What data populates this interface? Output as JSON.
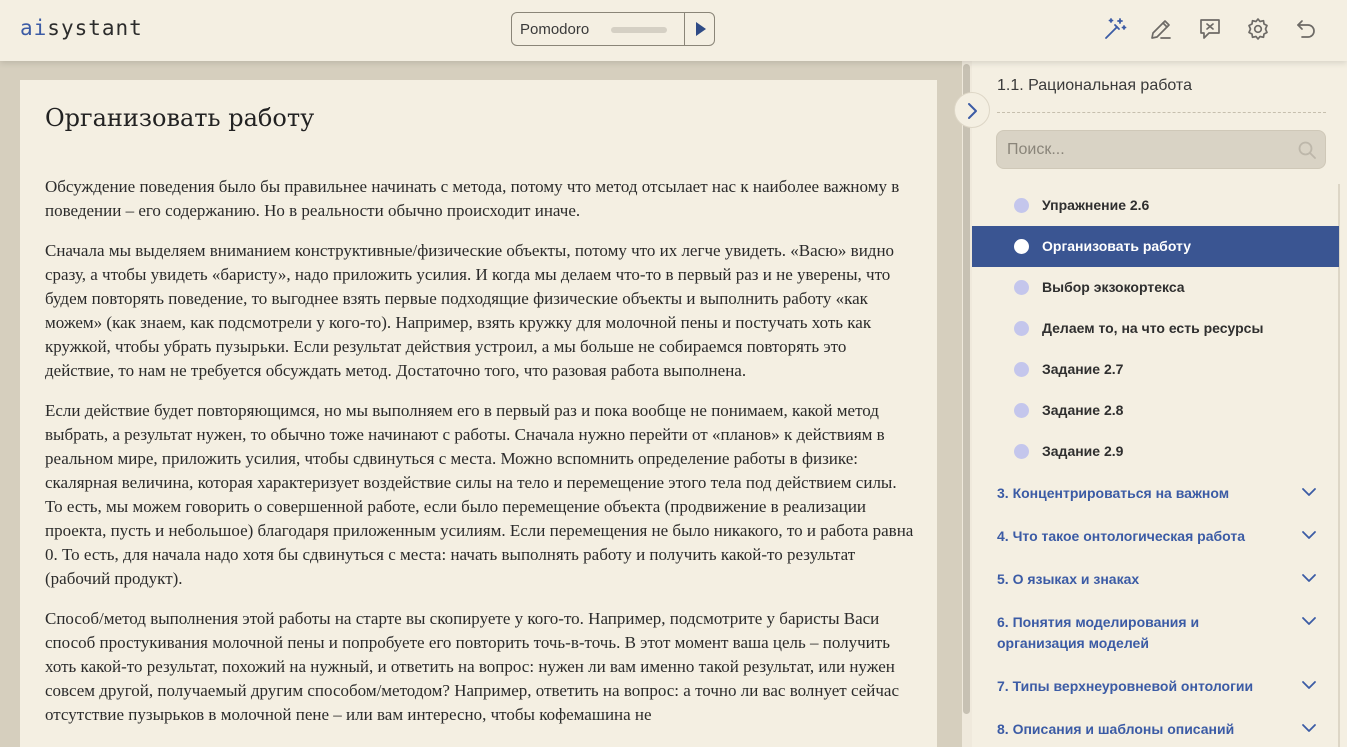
{
  "header": {
    "logo_ai": "ai",
    "logo_rest": "systant",
    "pomodoro": {
      "label": "Pomodoro",
      "progress": 0
    },
    "tools": [
      "magic-wand-icon",
      "pencil-icon",
      "feedback-icon",
      "settings-icon",
      "undo-icon"
    ]
  },
  "article": {
    "title": "Организовать работу",
    "paragraphs": [
      "Обсуждение поведения было бы правильнее начинать с метода, потому что метод отсылает нас к наиболее важному в поведении – его содержанию. Но в реальности обычно происходит иначе.",
      "Сначала мы выделяем вниманием конструктивные/физические объекты, потому что их легче увидеть. «Васю» видно сразу, а чтобы увидеть «баристу», надо приложить усилия. И когда мы делаем что-то в первый раз и не уверены, что будем повторять поведение, то выгоднее взять первые подходящие физические объекты и выполнить работу «как можем» (как знаем, как подсмотрели у кого-то). Например, взять кружку для молочной пены и постучать хоть как кружкой, чтобы убрать пузырьки. Если результат действия устроил, а мы больше не собираемся повторять это действие, то нам не требуется обсуждать метод. Достаточно того, что разовая работа выполнена.",
      "Если действие будет повторяющимся, но мы выполняем его в первый раз и пока вообще не понимаем, какой метод выбрать, а результат нужен, то обычно тоже начинают с работы. Сначала нужно перейти от «планов» к действиям в реальном мире, приложить усилия, чтобы сдвинуться с места. Можно вспомнить определение работы в физике: скалярная величина, которая характеризует воздействие силы на тело и перемещение этого тела под действием силы. То есть, мы можем говорить о совершенной работе, если было перемещение объекта (продвижение в реализации проекта, пусть и небольшое) благодаря приложенным усилиям. Если перемещения не было никакого, то и работа равна 0. То есть, для начала надо хотя бы сдвинуться с места: начать выполнять работу и получить какой-то результат (рабочий продукт).",
      "Способ/метод выполнения этой работы на старте вы скопируете у кого-то. Например, подсмотрите у баристы Васи способ простукивания молочной пены и попробуете его повторить точь-в-точь. В этот момент ваша цель – получить хоть какой-то результат, похожий на нужный, и ответить на вопрос: нужен ли вам именно такой результат, или нужен совсем другой, получаемый другим способом/методом? Например, ответить на вопрос: а точно ли вас волнует сейчас отсутствие пузырьков в молочной пене – или вам интересно, чтобы кофемашина не"
    ]
  },
  "sidebar": {
    "title": "1.1. Рациональная работа",
    "search_placeholder": "Поиск...",
    "lessons": [
      {
        "label": "Упражнение 2.6",
        "active": false
      },
      {
        "label": "Организовать работу",
        "active": true
      },
      {
        "label": "Выбор экзокортекса",
        "active": false
      },
      {
        "label": "Делаем то, на что есть ресурсы",
        "active": false
      },
      {
        "label": "Задание 2.7",
        "active": false
      },
      {
        "label": "Задание 2.8",
        "active": false
      },
      {
        "label": "Задание 2.9",
        "active": false
      }
    ],
    "sections": [
      "3. Концентрироваться на важном",
      "4. Что такое онтологическая работа",
      "5. О языках и знаках",
      "6. Понятия моделирования и организация моделей",
      "7. Типы верхнеуровневой онтологии",
      "8. Описания и шаблоны описаний"
    ]
  },
  "colors": {
    "accent": "#3a5592",
    "link": "#3b5ba5",
    "page_bg": "#f4efe2",
    "backdrop": "#d6cfbe",
    "dot": "#c4c6ec"
  }
}
